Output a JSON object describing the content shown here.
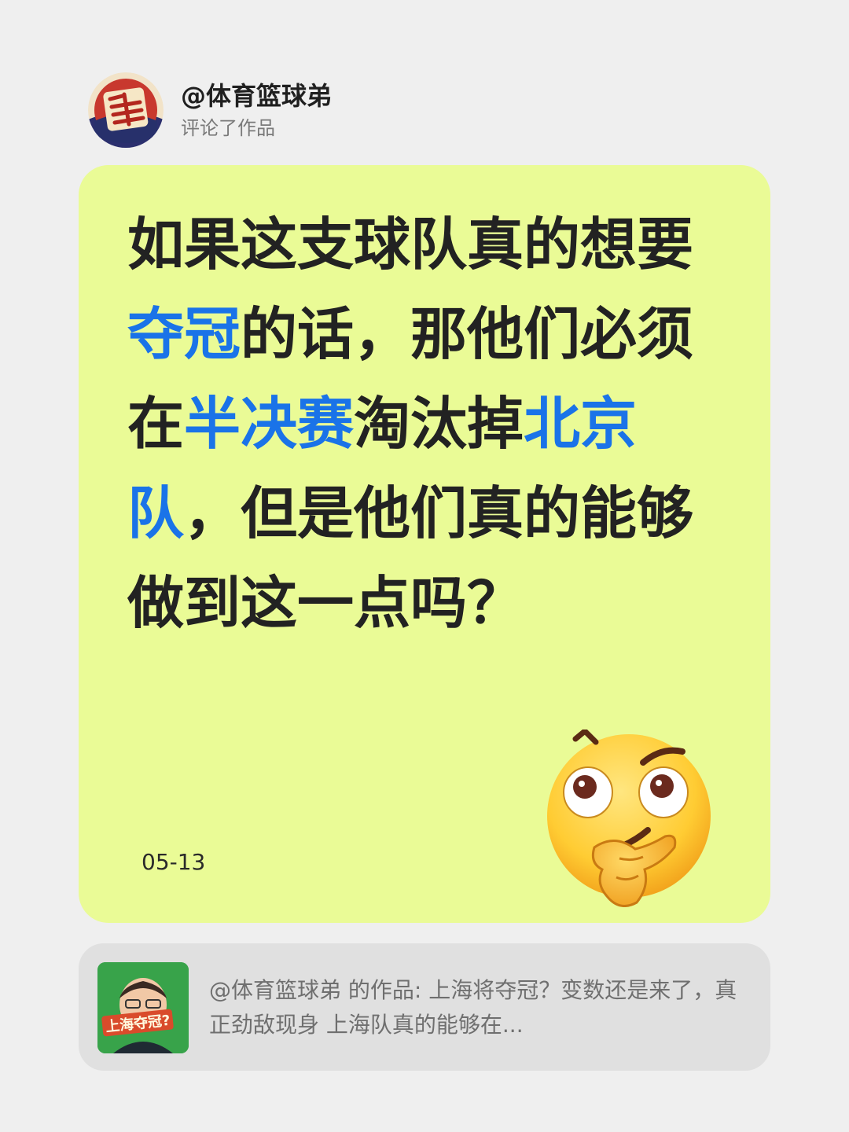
{
  "author": {
    "name": "@体育篮球弟",
    "action": "评论了作品",
    "avatar_icon": "basketball-brother-logo-icon"
  },
  "comment": {
    "segments": [
      {
        "text": "如果这支球队真的想要",
        "highlight": false
      },
      {
        "text": "夺冠",
        "highlight": true
      },
      {
        "text": "的话，那他们必须在",
        "highlight": false
      },
      {
        "text": "半决赛",
        "highlight": true
      },
      {
        "text": "淘汰掉",
        "highlight": false
      },
      {
        "text": "北京队",
        "highlight": true
      },
      {
        "text": "，但是他们真的能够做到这一点吗？",
        "highlight": false
      }
    ],
    "date": "05-13",
    "emoji": "thinking-face-icon"
  },
  "source": {
    "text": "@体育篮球弟 的作品: 上海将夺冠？变数还是来了，真正劲敌现身 上海队真的能够在...",
    "thumbnail_caption": "上海夺冠?"
  },
  "colors": {
    "background": "#efefef",
    "card": "#eafb96",
    "highlight": "#1a73e8",
    "source_card": "#e0e0e0"
  }
}
